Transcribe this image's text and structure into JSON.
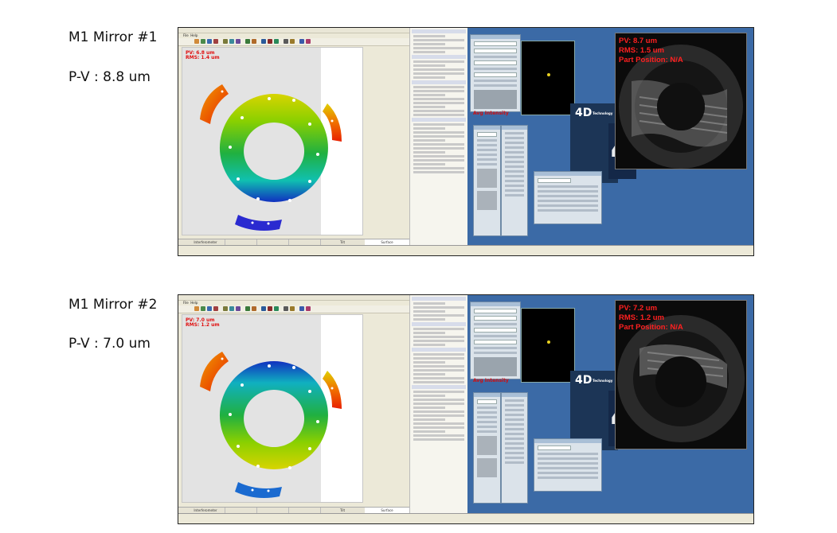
{
  "captions": [
    {
      "title": "M1 Mirror #1",
      "pv": "P-V : 8.8 um"
    },
    {
      "title": "M1 Mirror #2",
      "pv": "P-V : 7.0 um"
    }
  ],
  "screens": [
    {
      "plot_label": "PV: 6.8 um\nRMS: 1.4 um",
      "camera_label": "PV: 8.7 um\nRMS: 1.5 um\nPart Position: N/A",
      "avg_intensity": "Avg Intensity",
      "tabs": [
        "Interferometer",
        "",
        "",
        "",
        "Tilt",
        "Surface"
      ]
    },
    {
      "plot_label": "PV: 7.0 um\nRMS: 1.2 um",
      "camera_label": "PV: 7.2 um\nRMS: 1.2 um\nPart Position: N/A",
      "avg_intensity": "Avg Intensity",
      "tabs": [
        "Interferometer",
        "",
        "",
        "",
        "Tilt",
        "Surface"
      ]
    }
  ],
  "brand": {
    "text": "4D",
    "sub": "Technology",
    "big": "4"
  },
  "colors": {
    "desktop": "#3b6aa6",
    "label_red": "#e01010",
    "panel": "#dbe3ea"
  }
}
